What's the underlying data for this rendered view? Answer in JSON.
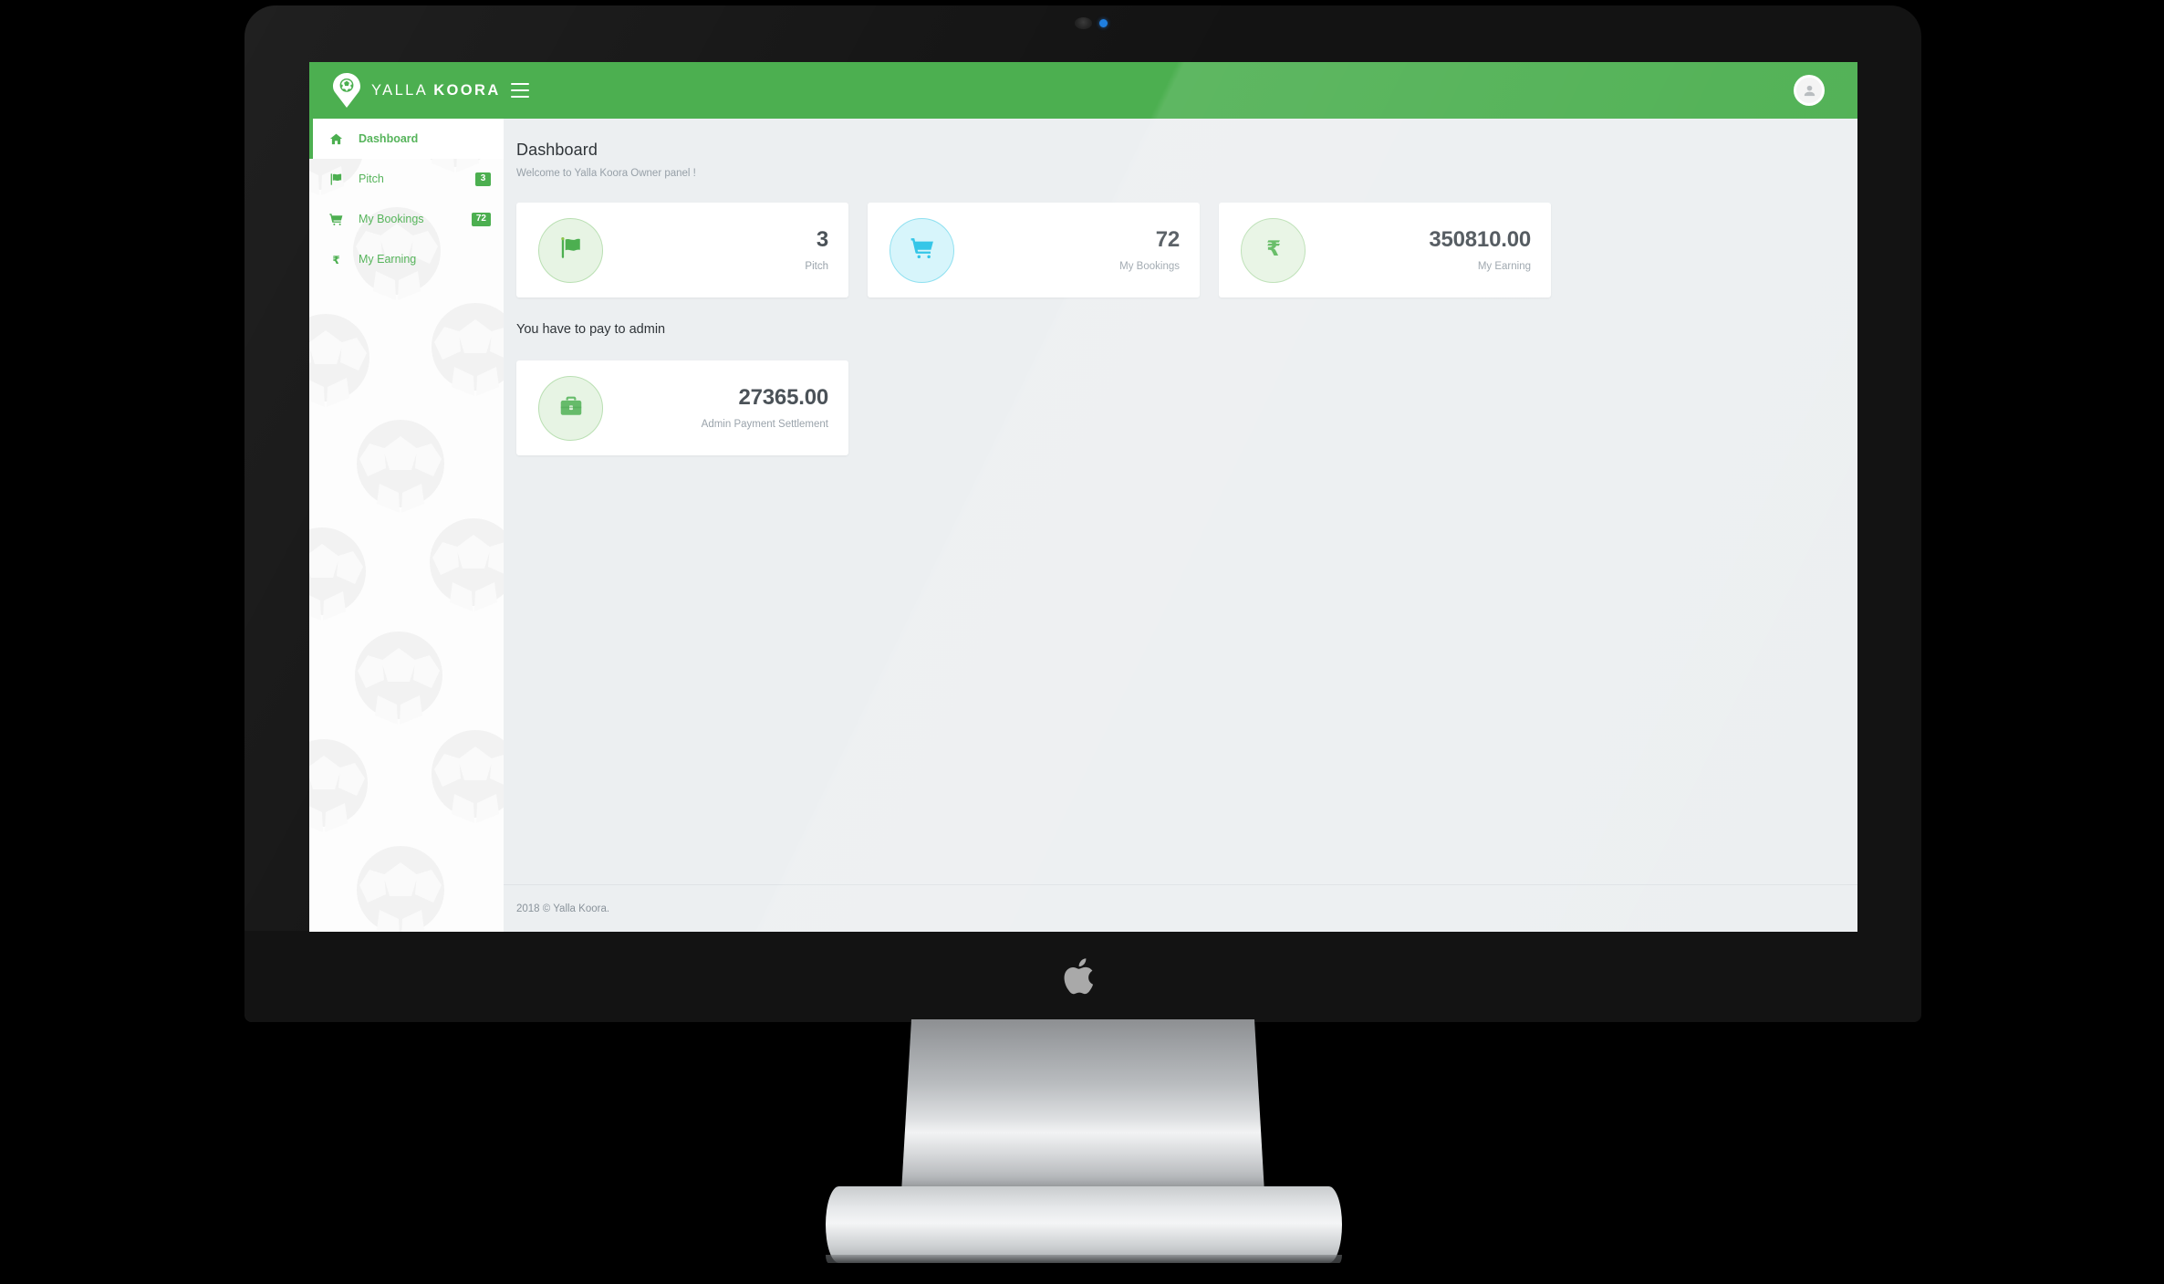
{
  "brand": {
    "name_thin": "YALLA",
    "name_bold": "KOORA",
    "logo_icon": "map-pin-soccer-ball-icon"
  },
  "topbar": {
    "menu_toggle_icon": "hamburger-icon",
    "avatar_icon": "user-avatar-icon"
  },
  "sidebar": {
    "items": [
      {
        "label": "Dashboard",
        "icon": "home-icon",
        "badge": "",
        "active": true
      },
      {
        "label": "Pitch",
        "icon": "flag-icon",
        "badge": "3",
        "active": false
      },
      {
        "label": "My Bookings",
        "icon": "shopping-cart-icon",
        "badge": "72",
        "active": false
      },
      {
        "label": "My Earning",
        "icon": "rupee-icon",
        "badge": "",
        "active": false
      }
    ]
  },
  "page": {
    "title": "Dashboard",
    "subtitle": "Welcome to Yalla Koora Owner panel !"
  },
  "stats": [
    {
      "value": "3",
      "label": "Pitch",
      "icon": "flag-icon",
      "circle_color": "#e7f4e4",
      "icon_color": "#4caf50"
    },
    {
      "value": "72",
      "label": "My Bookings",
      "icon": "shopping-cart-icon",
      "circle_color": "#d7f5fb",
      "icon_color": "#35c6e8"
    },
    {
      "value": "350810.00",
      "label": "My Earning",
      "icon": "rupee-icon",
      "circle_color": "#e7f4e4",
      "icon_color": "#5cb85c"
    }
  ],
  "admin_section": {
    "title": "You have to pay to admin",
    "card": {
      "value": "27365.00",
      "label": "Admin Payment Settlement",
      "icon": "briefcase-icon",
      "circle_color": "#e7f4e4",
      "icon_color": "#66bb6a"
    }
  },
  "footer": {
    "text": "2018 © Yalla Koora."
  },
  "colors": {
    "brand_green": "#4caf50",
    "page_bg": "#eceff1",
    "card_bg": "#ffffff",
    "cyan": "#35c6e8"
  },
  "device": {
    "apple_logo_icon": "apple-logo-icon",
    "webcam_icon": "webcam-icon",
    "webcam_led_icon": "led-indicator-icon"
  }
}
